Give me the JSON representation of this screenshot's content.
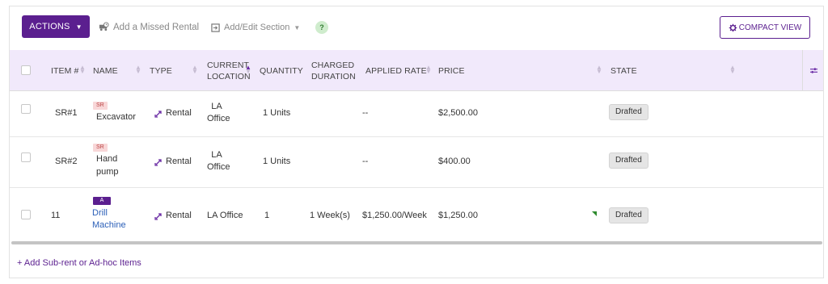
{
  "toolbar": {
    "actions_label": "ACTIONS",
    "missed_rental_label": "Add a Missed Rental",
    "add_edit_section_label": "Add/Edit Section",
    "help_label": "?",
    "compact_view_label": "COMPACT VIEW"
  },
  "table": {
    "headers": {
      "item": "ITEM #",
      "name": "NAME",
      "type": "TYPE",
      "location_line1": "CURRENT",
      "location_line2": "LOCATION",
      "quantity": "QUANTITY",
      "duration_line1": "CHARGED",
      "duration_line2": "DURATION",
      "applied_rate": "APPLIED RATE",
      "price": "PRICE",
      "state": "STATE"
    },
    "rows": [
      {
        "item": "SR#1",
        "badge": "SR",
        "name_line1": "Excavator",
        "name_line2": "",
        "type": "Rental",
        "location_line1": "LA",
        "location_line2": "Office",
        "quantity": "1 Units",
        "duration": "",
        "applied_rate": "--",
        "price": "$2,500.00",
        "state": "Drafted"
      },
      {
        "item": "SR#2",
        "badge": "SR",
        "name_line1": "Hand",
        "name_line2": "pump",
        "type": "Rental",
        "location_line1": "LA",
        "location_line2": "Office",
        "quantity": "1 Units",
        "duration": "",
        "applied_rate": "--",
        "price": "$400.00",
        "state": "Drafted"
      },
      {
        "item": "11",
        "badge": "A",
        "name_line1": "Drill",
        "name_line2": "Machine",
        "type": "Rental",
        "location": "LA Office",
        "quantity": "1",
        "duration": "1 Week(s)",
        "applied_rate": "$1,250.00/Week",
        "price": "$1,250.00",
        "state": "Drafted"
      }
    ]
  },
  "footer": {
    "add_items_label": "+ Add Sub-rent or Ad-hoc Items"
  },
  "colors": {
    "primary": "#5b1f8f",
    "header_bg": "#f1e9fb",
    "link": "#2b5fb8",
    "sr_badge_bg": "#f8d7d8",
    "help_bg": "#cfeccd"
  },
  "icons": {
    "missed_rental": "truck-clock-icon",
    "add_edit_section": "section-edit-icon",
    "compact_view": "gear-icon",
    "type_rental": "swap-arrows-icon",
    "column_settings": "sliders-icon"
  }
}
